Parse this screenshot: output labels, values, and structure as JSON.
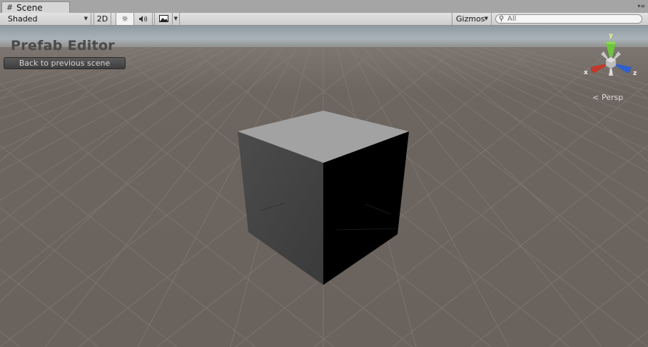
{
  "tab": {
    "label": "Scene",
    "icon": "grid-icon"
  },
  "toolbar": {
    "shading_mode": "Shaded",
    "mode_2d_label": "2D",
    "lighting_icon": "sun-icon",
    "audio_icon": "speaker-icon",
    "effects_icon": "image-icon",
    "gizmos_label": "Gizmos",
    "search_placeholder": "All"
  },
  "viewport": {
    "title": "Prefab Editor",
    "back_button_label": "Back to previous scene",
    "projection_label": "Persp",
    "axes": {
      "x": "x",
      "y": "y",
      "z": "z"
    }
  }
}
